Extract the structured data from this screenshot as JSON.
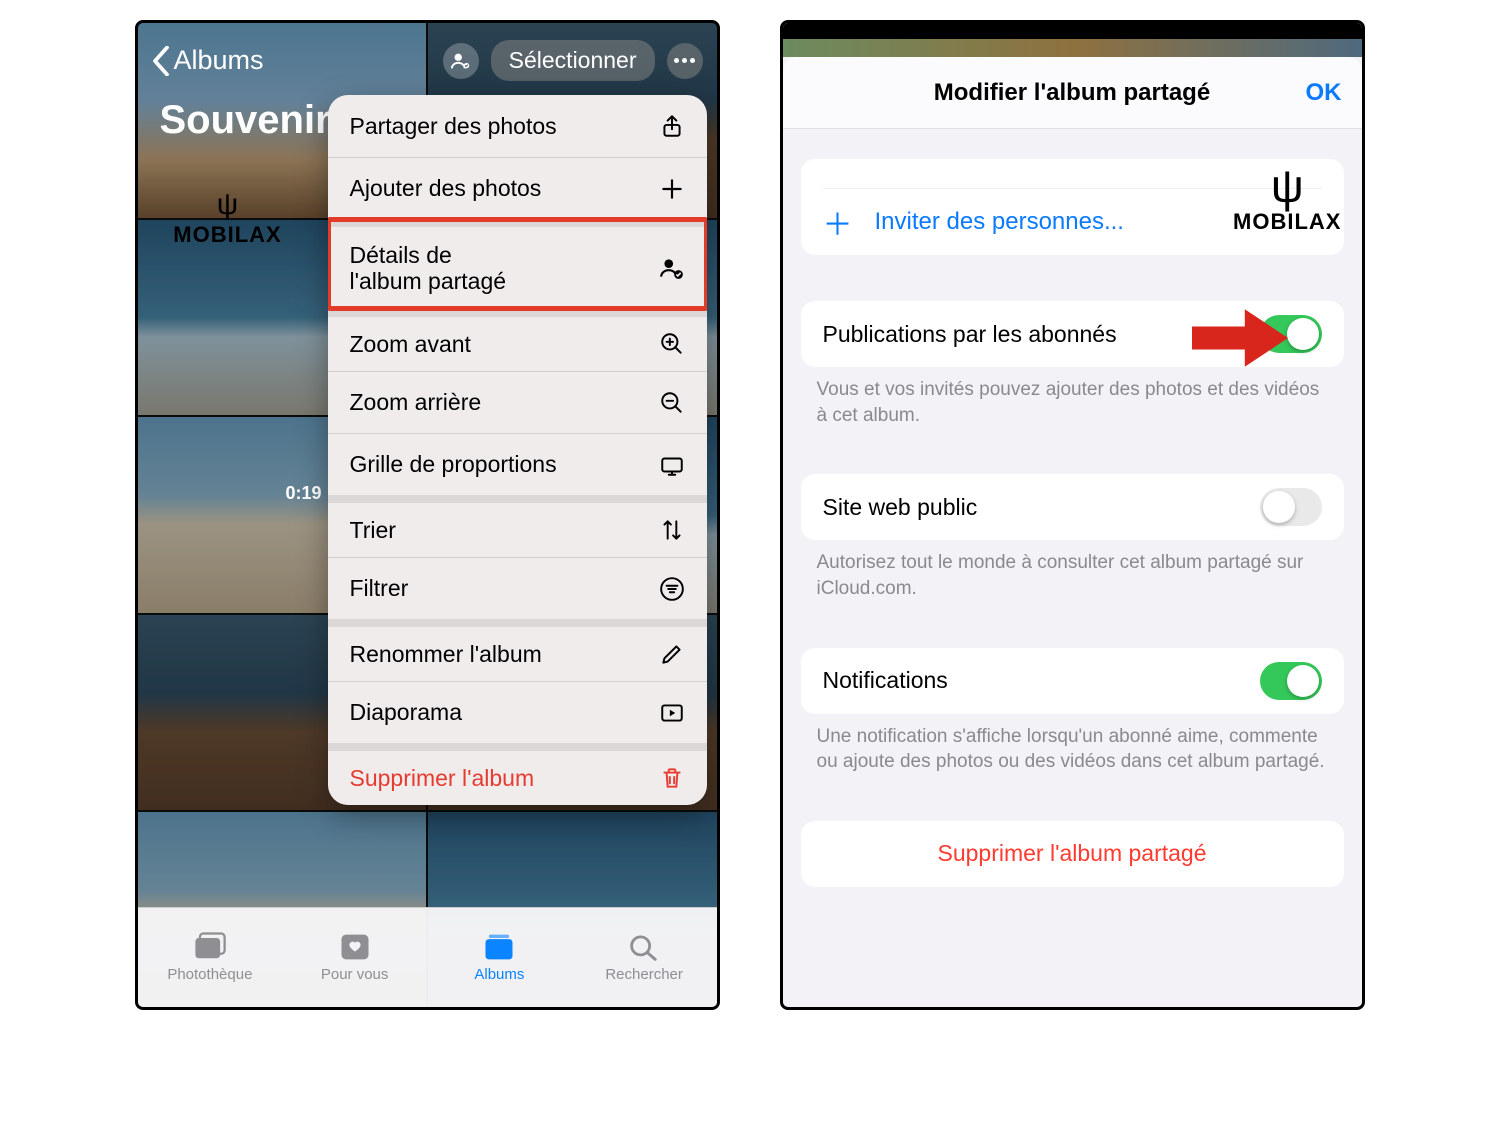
{
  "watermark": "MOBILAX",
  "left": {
    "back_label": "Albums",
    "select_label": "Sélectionner",
    "album_title": "Souvenir",
    "video_duration": "0:19",
    "menu": {
      "share": "Partager des photos",
      "add": "Ajouter des photos",
      "details_l1": "Détails de",
      "details_l2": "l'album partagé",
      "zoom_in": "Zoom avant",
      "zoom_out": "Zoom arrière",
      "aspect": "Grille de proportions",
      "sort": "Trier",
      "filter": "Filtrer",
      "rename": "Renommer l'album",
      "slideshow": "Diaporama",
      "delete": "Supprimer l'album"
    },
    "tabs": {
      "library": "Photothèque",
      "for_you": "Pour vous",
      "albums": "Albums",
      "search": "Rechercher"
    }
  },
  "right": {
    "header_title": "Modifier l'album partagé",
    "ok": "OK",
    "invite": "Inviter des personnes...",
    "subscriber_posting": {
      "label": "Publications par les abonnés",
      "on": true,
      "hint": "Vous et vos invités pouvez ajouter des photos et des vidéos à cet album."
    },
    "public_site": {
      "label": "Site web public",
      "on": false,
      "hint": "Autorisez tout le monde à consulter cet album partagé sur iCloud.com."
    },
    "notifications": {
      "label": "Notifications",
      "on": true,
      "hint": "Une notification s'affiche lorsqu'un abonné aime, commente ou ajoute des photos ou des vidéos dans cet album partagé."
    },
    "delete": "Supprimer l'album partagé"
  }
}
